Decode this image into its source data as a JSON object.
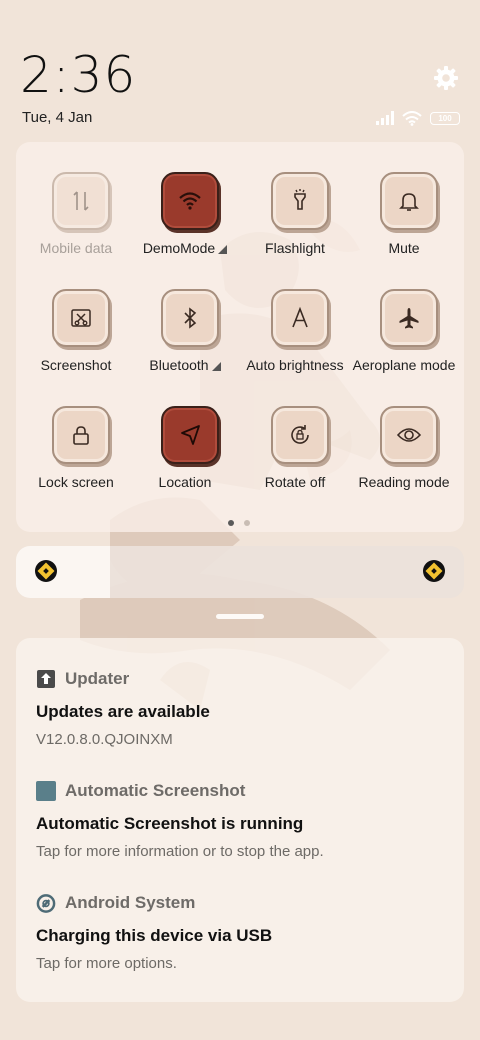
{
  "status": {
    "time": "2:36",
    "date": "Tue, 4 Jan",
    "battery": "100"
  },
  "quick_settings": {
    "tiles": [
      {
        "label": "Mobile data",
        "icon": "mobile-data-icon",
        "state": "disabled",
        "caret": false
      },
      {
        "label": "DemoMode",
        "icon": "wifi-icon",
        "state": "active",
        "caret": true
      },
      {
        "label": "Flashlight",
        "icon": "flashlight-icon",
        "state": "off",
        "caret": false
      },
      {
        "label": "Mute",
        "icon": "bell-icon",
        "state": "off",
        "caret": false
      },
      {
        "label": "Screenshot",
        "icon": "screenshot-icon",
        "state": "off",
        "caret": false
      },
      {
        "label": "Bluetooth",
        "icon": "bluetooth-icon",
        "state": "off",
        "caret": true
      },
      {
        "label": "Auto brightness",
        "icon": "auto-brightness-icon",
        "state": "off",
        "caret": false
      },
      {
        "label": "Aeroplane mode",
        "icon": "airplane-icon",
        "state": "off",
        "caret": false
      },
      {
        "label": "Lock screen",
        "icon": "lock-icon",
        "state": "off",
        "caret": false
      },
      {
        "label": "Location",
        "icon": "location-icon",
        "state": "active",
        "caret": false
      },
      {
        "label": "Rotate off",
        "icon": "rotate-lock-icon",
        "state": "off",
        "caret": false
      },
      {
        "label": "Reading mode",
        "icon": "eye-icon",
        "state": "off",
        "caret": false
      }
    ],
    "page_count": 2,
    "current_page": 1
  },
  "brightness": {
    "level": 0.21
  },
  "notifications": [
    {
      "app": "Updater",
      "icon": "updater-icon",
      "title": "Updates are available",
      "text": "V12.0.8.0.QJOINXM"
    },
    {
      "app": "Automatic Screenshot",
      "icon": "screenshot-app-icon",
      "title": "Automatic Screenshot is running",
      "text": "Tap for more information or to stop the app."
    },
    {
      "app": "Android System",
      "icon": "android-system-icon",
      "title": "Charging this device via USB",
      "text": "Tap for more options."
    }
  ],
  "colors": {
    "background": "#f1e4d9",
    "tile_active": "#9a3a2c",
    "tile_inactive": "#ecd6c6",
    "brightness_icon": "#f2c230"
  }
}
